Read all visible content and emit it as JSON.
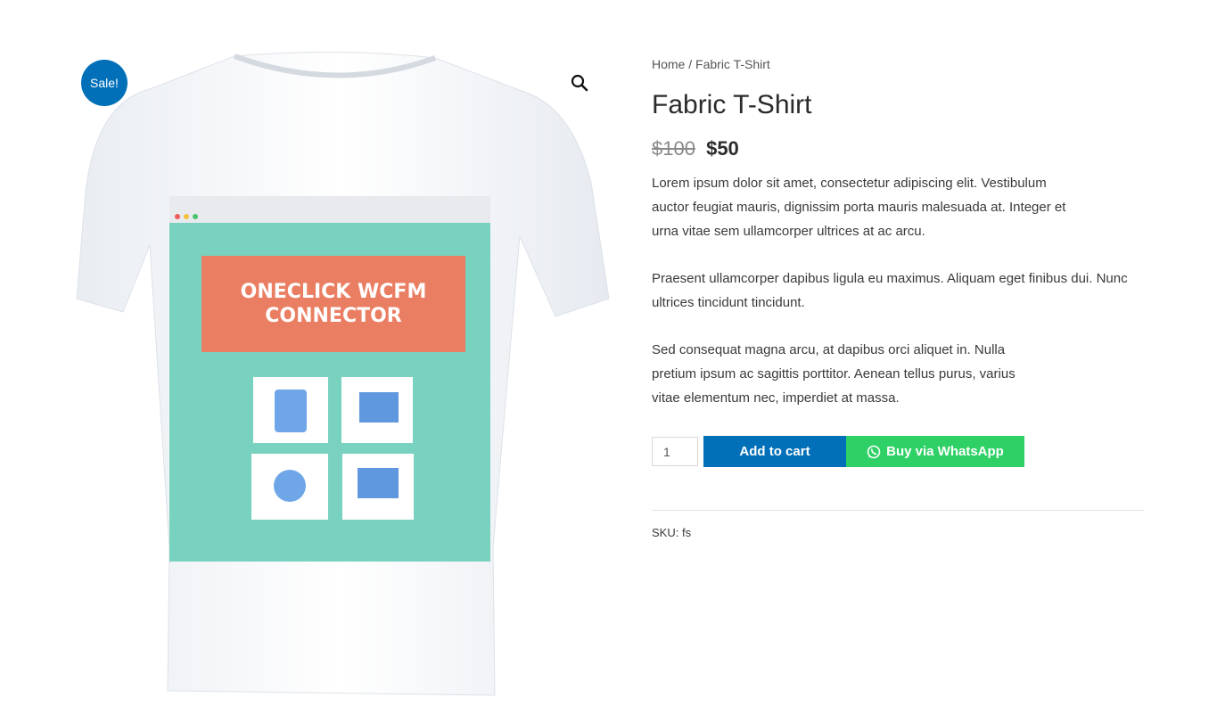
{
  "badge": {
    "sale_label": "Sale!",
    "color": "#0170b9"
  },
  "gallery": {
    "zoom_icon": "magnifier-icon",
    "shirt_print": {
      "line1": "ONECLICK WCFM",
      "line2": "CONNECTOR"
    }
  },
  "breadcrumb": {
    "home": "Home",
    "separator": "/",
    "current": "Fabric T-Shirt"
  },
  "product": {
    "title": "Fabric T-Shirt",
    "price_old": "$100",
    "price_new": "$50",
    "description": [
      "Lorem ipsum dolor sit amet, consectetur adipiscing elit. Vestibulum auctor feugiat mauris, dignissim porta mauris malesuada at. Integer et urna vitae sem ullamcorper ultrices at ac arcu.",
      "Praesent ullamcorper dapibus ligula eu maximus. Aliquam eget finibus dui. Nunc ultrices tincidunt tincidunt.",
      "Sed consequat magna arcu, at dapibus orci aliquet in. Nulla pretium ipsum ac sagittis porttitor. Aenean tellus purus, varius vitae elementum nec, imperdiet at massa."
    ],
    "quantity": "1",
    "add_to_cart": "Add to cart",
    "whatsapp_label": "Buy via WhatsApp",
    "whatsapp_icon": "whatsapp-icon",
    "sku_label": "SKU:",
    "sku_value": "fs"
  },
  "colors": {
    "accent": "#0170b9",
    "whatsapp": "#2fd167"
  }
}
